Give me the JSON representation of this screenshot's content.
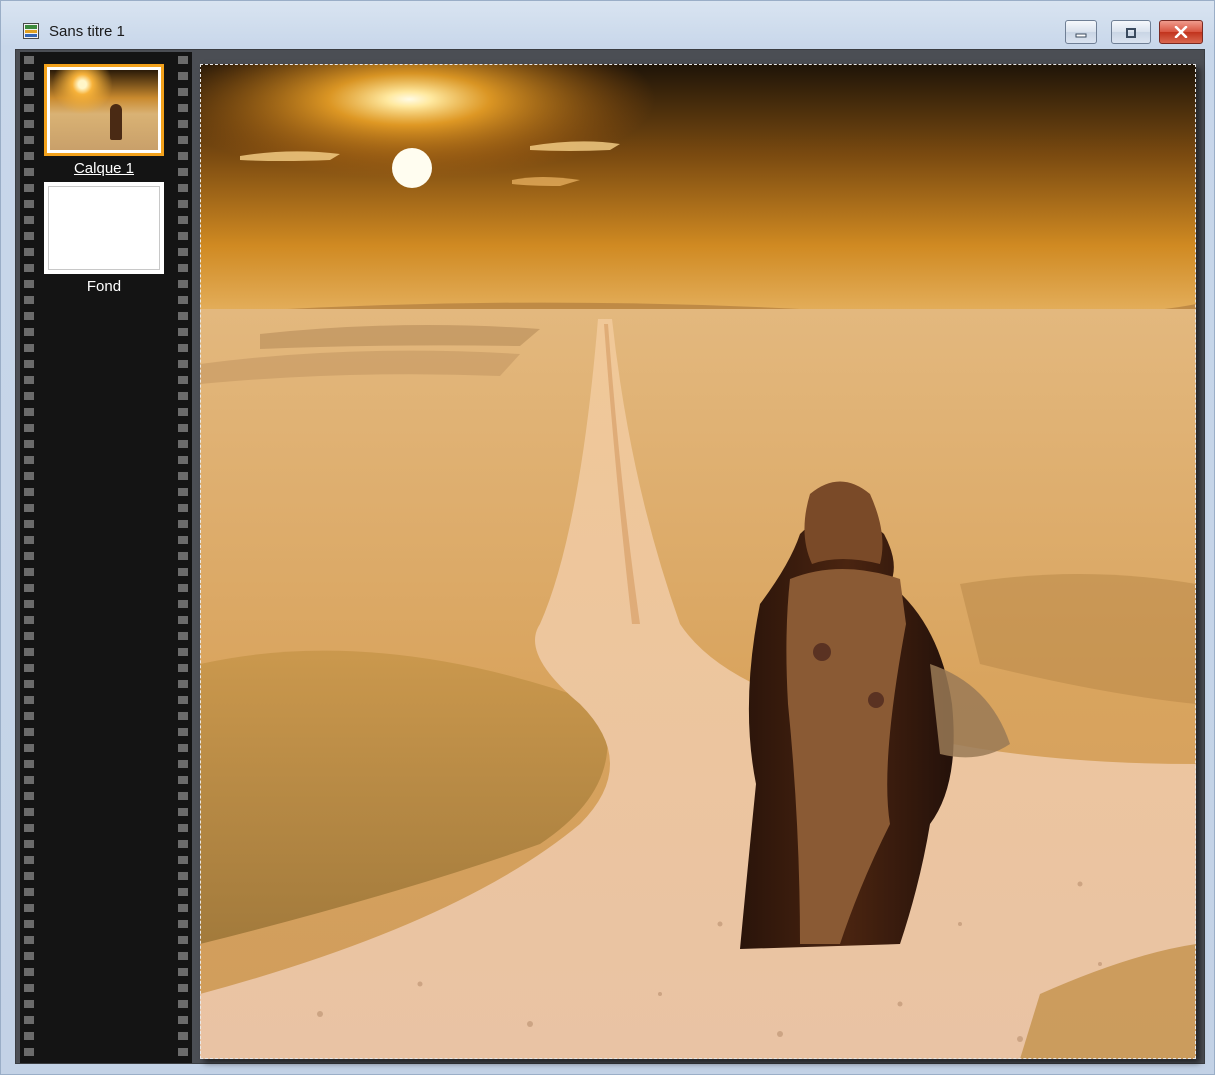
{
  "window": {
    "title": "Sans titre 1",
    "icon": "image-document-icon",
    "controls": [
      "minimize-icon",
      "maximize-icon",
      "close-icon"
    ]
  },
  "layers_panel": {
    "layers": [
      {
        "label": "Calque 1",
        "selected": true,
        "thumbnail": "photo"
      },
      {
        "label": "Fond",
        "selected": false,
        "thumbnail": "blank"
      }
    ]
  },
  "colors": {
    "selection_accent": "#f3a21c",
    "filmstrip": "#141414",
    "close_button": "#c1331d"
  }
}
